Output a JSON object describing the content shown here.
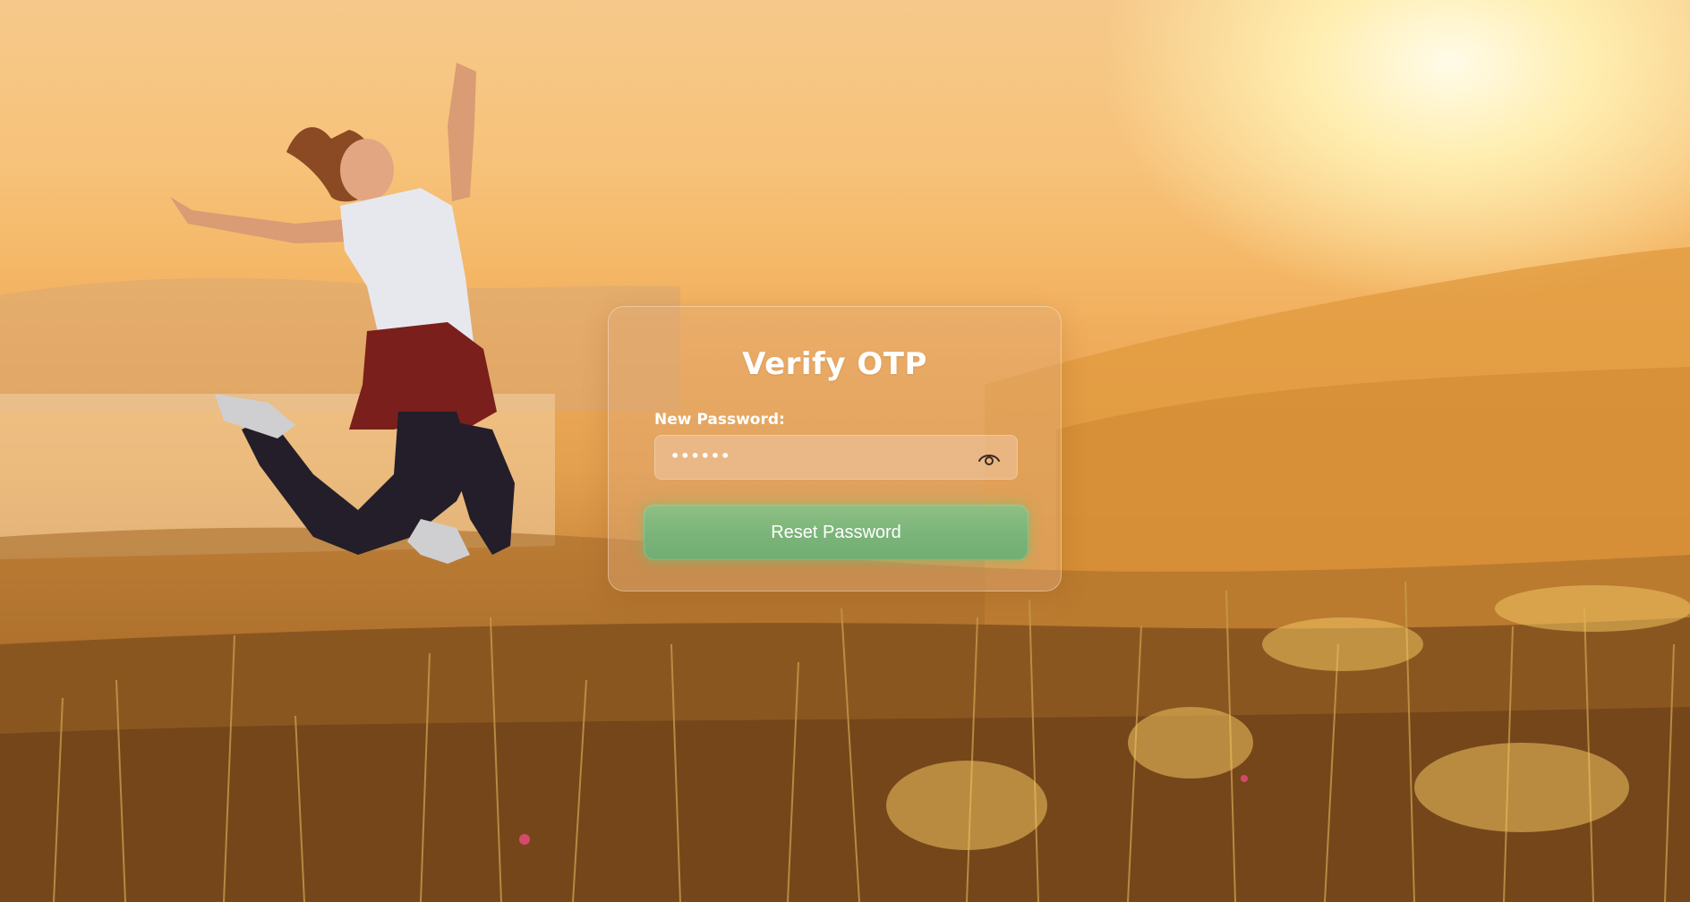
{
  "card": {
    "title": "Verify OTP",
    "password_label": "New Password:",
    "password_value": "••••••",
    "reset_button_label": "Reset Password"
  },
  "icons": {
    "visibility_toggle": "eye-icon"
  },
  "colors": {
    "button_green": "#7cb57a",
    "card_tint": "#e1aa78",
    "text_white": "#ffffff"
  }
}
